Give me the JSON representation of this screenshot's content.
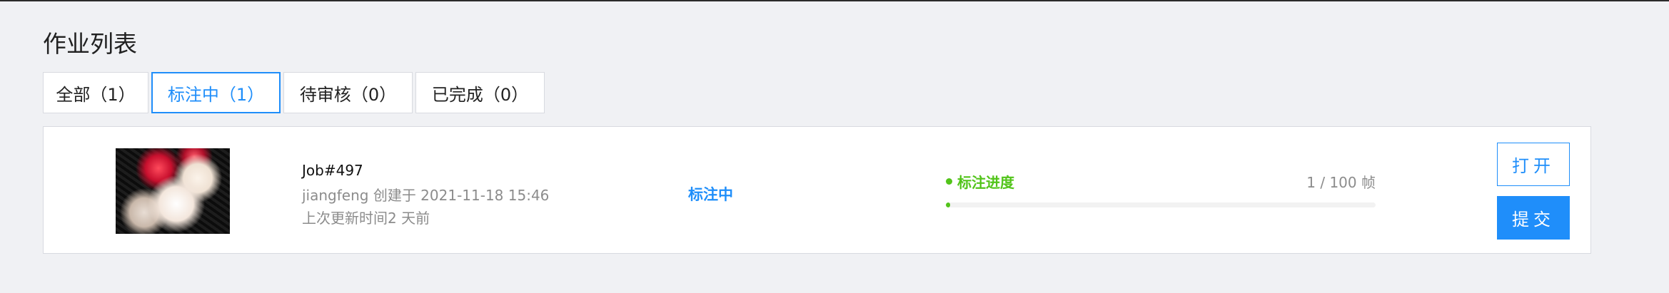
{
  "page": {
    "title": "作业列表"
  },
  "tabs": [
    {
      "label": "全部（1）"
    },
    {
      "label": "标注中（1）",
      "active": true
    },
    {
      "label": "待审核（0）"
    },
    {
      "label": "已完成（0）"
    }
  ],
  "job": {
    "id": "Job#497",
    "meta": "jiangfeng 创建于 2021-11-18 15:46",
    "updated": "上次更新时间2 天前",
    "status": "标注中",
    "progress_label": "标注进度",
    "progress_count": "1 / 100 帧",
    "progress_fraction": 0.01,
    "open_label": "打开",
    "submit_label": "提交"
  },
  "colors": {
    "accent": "#1f8efa",
    "success": "#52c41a",
    "muted_text": "#8c8c8c",
    "background": "#f0f1f4"
  },
  "icons": {
    "progress_dot": "status-dot-icon"
  }
}
